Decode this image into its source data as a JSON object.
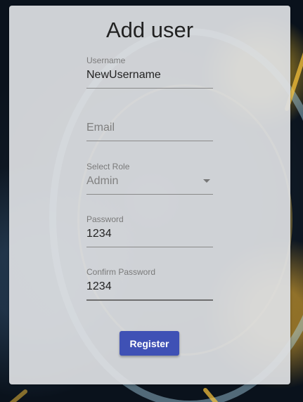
{
  "form": {
    "title": "Add user",
    "username": {
      "label": "Username",
      "value": "NewUsername"
    },
    "email": {
      "placeholder": "Email",
      "value": ""
    },
    "role": {
      "label": "Select Role",
      "value": "Admin"
    },
    "password": {
      "label": "Password",
      "value": "1234"
    },
    "confirm_password": {
      "label": "Confirm Password",
      "value": "1234"
    },
    "submit_label": "Register"
  },
  "colors": {
    "accent": "#3f51b5",
    "card_bg": "#dee0e3"
  },
  "icons": {
    "role_dropdown": "caret-down-icon"
  }
}
